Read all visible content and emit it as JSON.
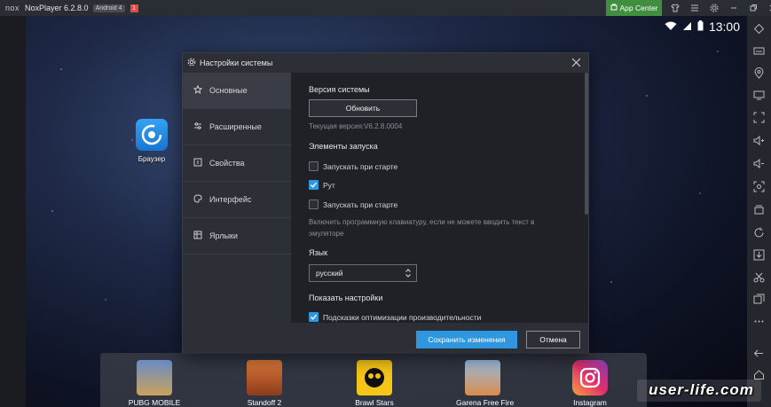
{
  "window": {
    "logo": "nox",
    "title": "NoxPlayer 6.2.8.0",
    "android_badge": "Android 4",
    "notification_badge": "1",
    "app_center_label": "App Center"
  },
  "status_bar": {
    "time": "13:00"
  },
  "desktop": {
    "browser_label": "Браузер"
  },
  "dock": {
    "apps": [
      {
        "label": "PUBG MOBILE",
        "icon": "pubg-icon"
      },
      {
        "label": "Standoff 2",
        "icon": "standoff-icon"
      },
      {
        "label": "Brawl Stars",
        "icon": "brawl-stars-icon"
      },
      {
        "label": "Garena Free Fire",
        "icon": "free-fire-icon"
      },
      {
        "label": "Instagram",
        "icon": "instagram-icon"
      }
    ]
  },
  "dialog": {
    "title": "Настройки системы",
    "nav": [
      {
        "label": "Основные",
        "icon": "star-icon",
        "active": true
      },
      {
        "label": "Расширенные",
        "icon": "sliders-icon",
        "active": false
      },
      {
        "label": "Свойства",
        "icon": "info-icon",
        "active": false
      },
      {
        "label": "Интерфейс",
        "icon": "palette-icon",
        "active": false
      },
      {
        "label": "Ярлыки",
        "icon": "grid-icon",
        "active": false
      }
    ],
    "version_section": "Версия системы",
    "update_button": "Обновить",
    "current_version": "Текущая версия:V6.2.8.0004",
    "startup_section": "Элементы запуска",
    "checkboxes": [
      {
        "label": "Запускать при старте",
        "checked": false
      },
      {
        "label": "Рут",
        "checked": true
      },
      {
        "label": "Запускать при старте",
        "checked": false
      }
    ],
    "keyboard_hint": "Включить программную клавиатуру, если не можете вводить текст в эмуляторе",
    "language_section": "Язык",
    "language_value": "русский",
    "show_settings_section": "Показать настройки",
    "perf_tips_label": "Подсказки оптимизации производительности",
    "perf_tips_checked": true,
    "save_button": "Сохранить изменения",
    "cancel_button": "Отмена"
  },
  "watermark": "user-life.com",
  "colors": {
    "accent": "#2f97df",
    "app_center": "#3f8f3f",
    "titlebar": "#2b2d34"
  }
}
